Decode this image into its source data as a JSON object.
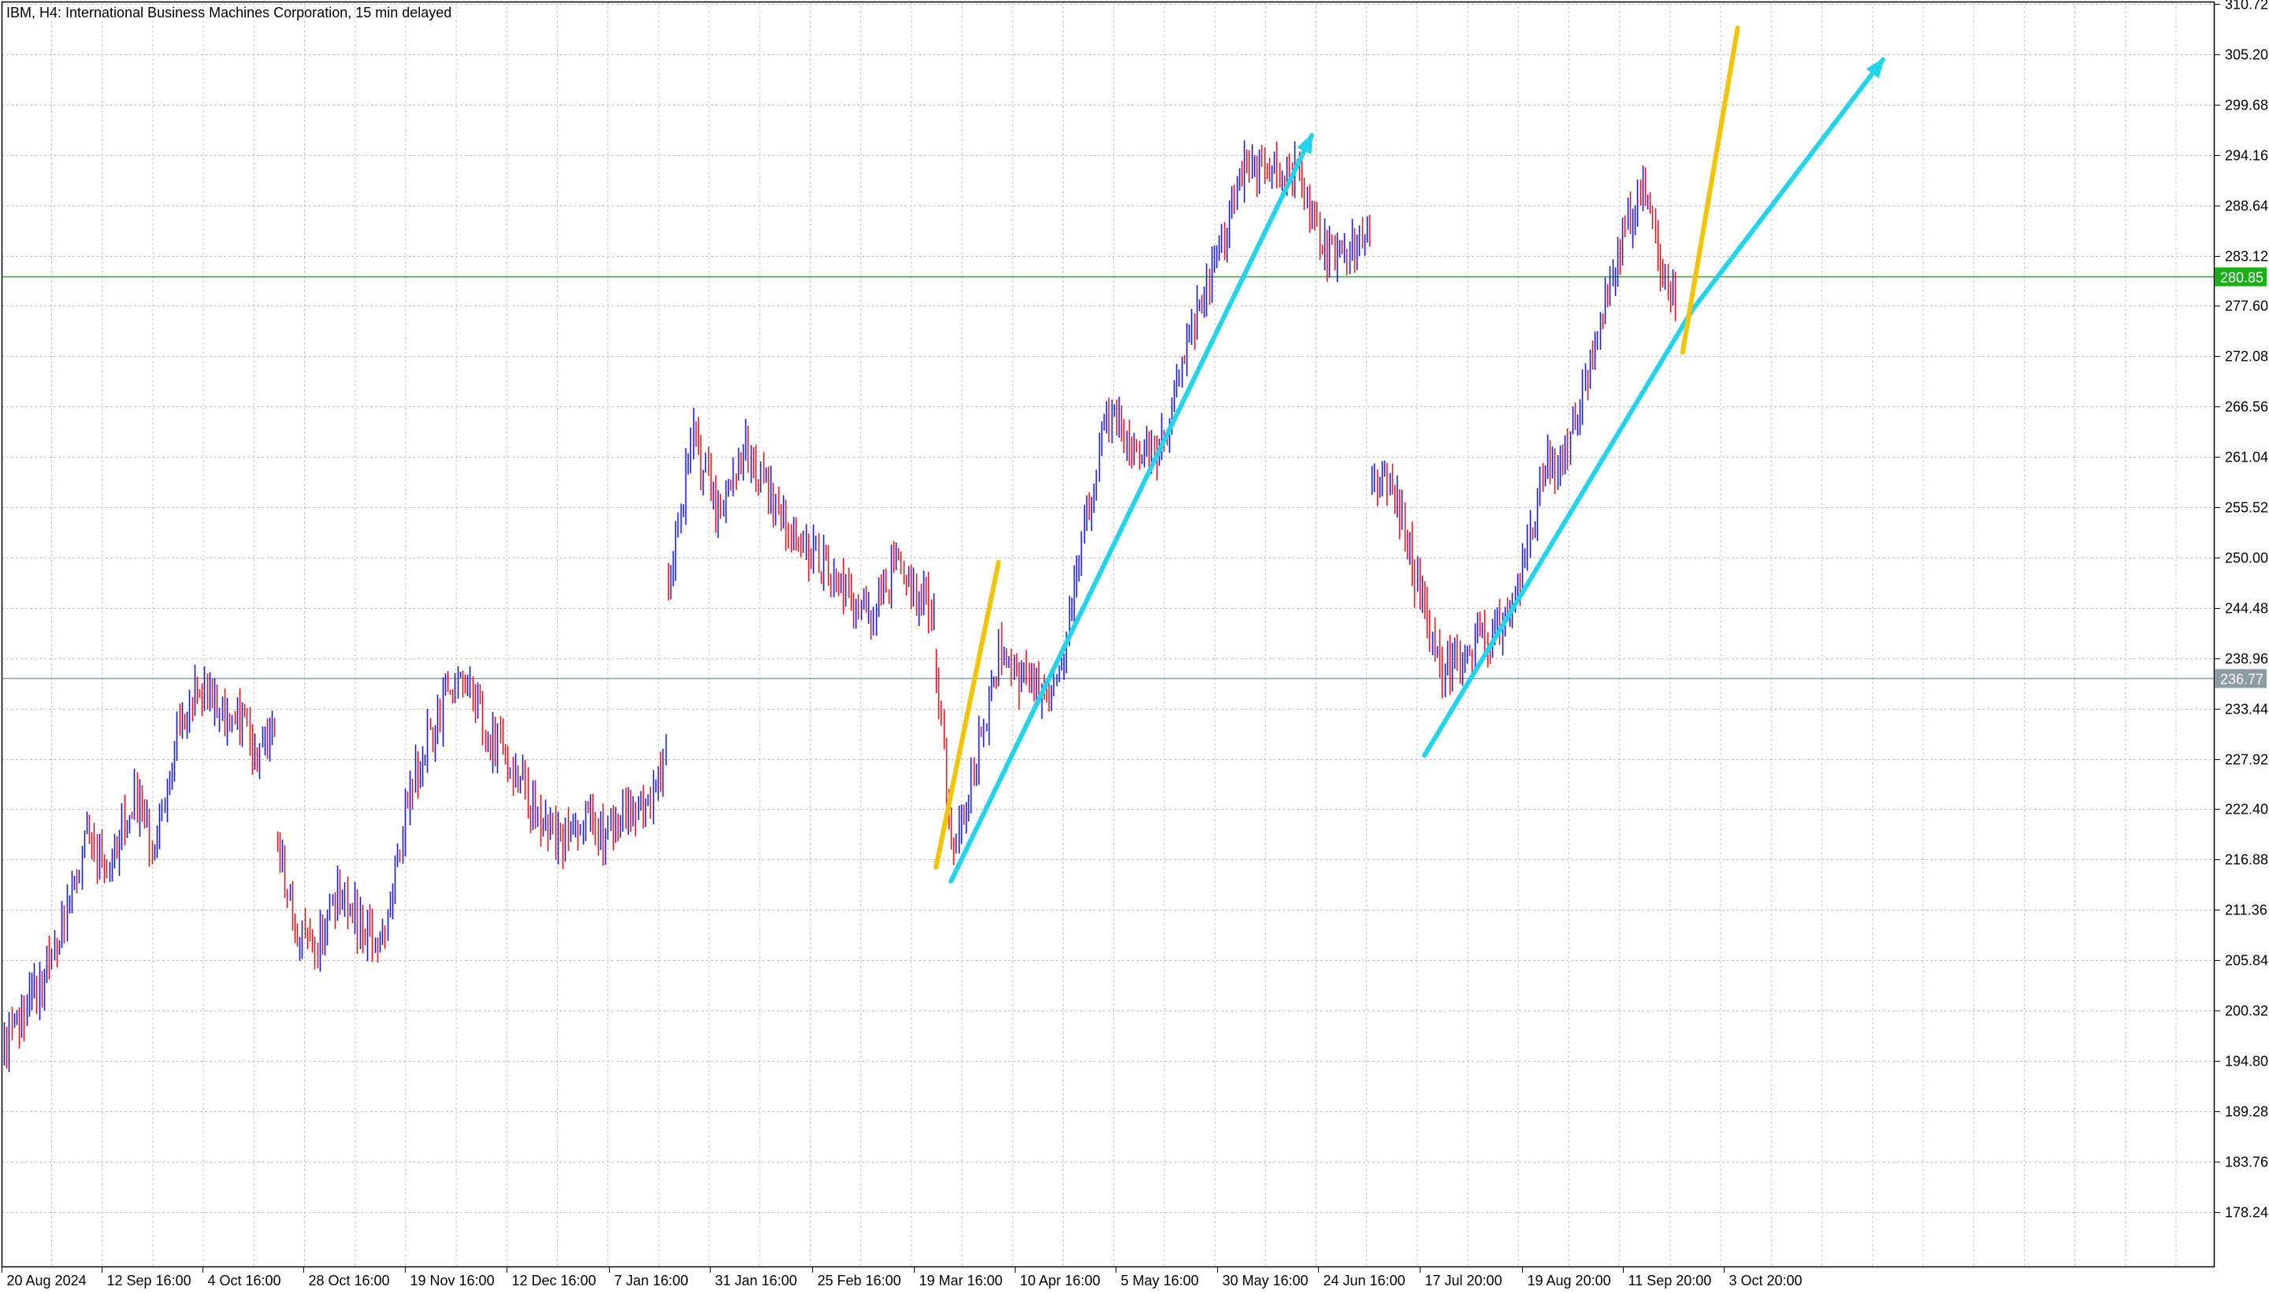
{
  "header": {
    "title": "IBM, H4:  International Business Machines Corporation, 15 min delayed"
  },
  "colors": {
    "background": "#ffffff",
    "grid": "#c8c8c8",
    "axis": "#000000",
    "up_candle": "#1a1ad8",
    "down_candle": "#e0141e",
    "cyan_line": "#22d4ec",
    "yellow_line": "#f5c400",
    "green_line": "#19b019",
    "grey_line": "#8c9ca4"
  },
  "chart_data": {
    "type": "candlestick",
    "symbol": "IBM",
    "timeframe": "H4",
    "ylim": [
      172.2,
      310.72
    ],
    "grid": true,
    "y_ticks": [
      310.72,
      305.2,
      299.68,
      294.16,
      288.64,
      283.12,
      277.6,
      272.08,
      266.56,
      261.04,
      255.52,
      250.0,
      244.48,
      238.96,
      233.44,
      227.92,
      222.4,
      216.88,
      211.36,
      205.84,
      200.32,
      194.8,
      189.28,
      183.76,
      178.24
    ],
    "x_ticks": [
      "20 Aug 2024",
      "12 Sep 16:00",
      "4 Oct 16:00",
      "28 Oct 16:00",
      "19 Nov 16:00",
      "12 Dec 16:00",
      "7 Jan 16:00",
      "31 Jan 16:00",
      "25 Feb 16:00",
      "19 Mar 16:00",
      "10 Apr 16:00",
      "5 May 16:00",
      "30 May 16:00",
      "24 Jun 16:00",
      "17 Jul 20:00",
      "19 Aug 20:00",
      "11 Sep 20:00",
      "3 Oct 20:00"
    ],
    "price_segments": [
      {
        "start_bar": 0,
        "end_bar": 108,
        "points": [
          [
            0,
            196
          ],
          [
            10,
            201
          ],
          [
            22,
            208
          ],
          [
            32,
            220
          ],
          [
            42,
            216
          ],
          [
            52,
            224
          ],
          [
            60,
            218
          ],
          [
            70,
            232
          ],
          [
            80,
            236
          ],
          [
            90,
            232
          ],
          [
            95,
            232
          ],
          [
            100,
            229
          ],
          [
            104,
            230
          ],
          [
            108,
            231
          ]
        ]
      },
      {
        "start_bar": 109,
        "end_bar": 264,
        "points": [
          [
            109,
            219
          ],
          [
            118,
            208
          ],
          [
            124,
            207
          ],
          [
            134,
            214
          ],
          [
            142,
            210
          ],
          [
            150,
            207
          ],
          [
            162,
            225
          ],
          [
            174,
            233
          ],
          [
            182,
            238
          ],
          [
            192,
            231
          ],
          [
            200,
            228
          ],
          [
            212,
            222
          ],
          [
            222,
            219
          ],
          [
            232,
            221
          ],
          [
            240,
            219
          ],
          [
            252,
            222
          ],
          [
            264,
            227
          ]
        ]
      },
      {
        "start_bar": 265,
        "end_bar": 371,
        "points": [
          [
            265,
            248
          ],
          [
            275,
            263
          ],
          [
            285,
            255
          ],
          [
            295,
            262
          ],
          [
            305,
            257
          ],
          [
            315,
            252
          ],
          [
            325,
            250
          ],
          [
            335,
            246
          ],
          [
            345,
            243
          ],
          [
            355,
            249
          ],
          [
            365,
            246
          ],
          [
            371,
            244
          ]
        ]
      },
      {
        "start_bar": 372,
        "end_bar": 545,
        "points": [
          [
            372,
            238
          ],
          [
            378,
            218
          ],
          [
            386,
            226
          ],
          [
            398,
            240
          ],
          [
            408,
            236
          ],
          [
            418,
            234
          ],
          [
            428,
            248
          ],
          [
            440,
            266
          ],
          [
            452,
            262
          ],
          [
            462,
            262
          ],
          [
            472,
            273
          ],
          [
            484,
            282
          ],
          [
            494,
            292
          ],
          [
            505,
            293
          ],
          [
            516,
            292
          ],
          [
            526,
            284
          ],
          [
            534,
            283
          ],
          [
            545,
            285
          ]
        ]
      },
      {
        "start_bar": 546,
        "end_bar": 667,
        "points": [
          [
            546,
            259
          ],
          [
            555,
            258
          ],
          [
            565,
            246
          ],
          [
            574,
            238
          ],
          [
            584,
            240
          ],
          [
            594,
            241
          ],
          [
            604,
            245
          ],
          [
            614,
            259
          ],
          [
            624,
            261
          ],
          [
            634,
            273
          ],
          [
            644,
            284
          ],
          [
            654,
            291
          ],
          [
            662,
            280
          ],
          [
            667,
            279
          ]
        ]
      }
    ],
    "current_price": 280.85,
    "reference_price": 236.77,
    "annotations": [
      {
        "type": "arrow",
        "color": "cyan",
        "from": [
          378,
          214.5
        ],
        "to": [
          522,
          296.3
        ]
      },
      {
        "type": "line",
        "color": "yellow",
        "from": [
          372,
          216
        ],
        "to": [
          397,
          249.5
        ]
      },
      {
        "type": "line",
        "color": "cyan",
        "from": [
          567,
          228.3
        ],
        "to": [
          674,
          277.2
        ]
      },
      {
        "type": "arrow",
        "color": "cyan",
        "from": [
          674,
          277.2
        ],
        "to": [
          750,
          304.6
        ]
      },
      {
        "type": "line",
        "color": "yellow",
        "from": [
          670,
          272.5
        ],
        "to": [
          692,
          308.1
        ]
      }
    ]
  }
}
